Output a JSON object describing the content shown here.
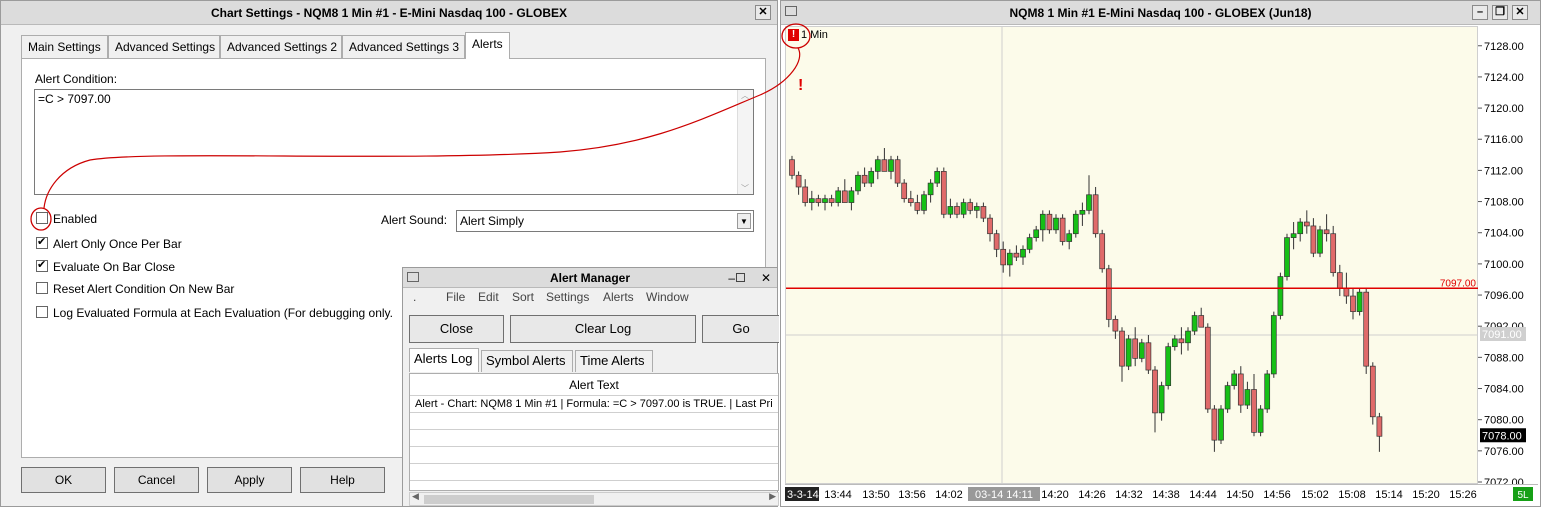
{
  "settings_window": {
    "title": "Chart Settings - NQM8  1 Min   #1 - E-Mini Nasdaq 100 - GLOBEX",
    "tabs": [
      "Main Settings",
      "Advanced Settings",
      "Advanced Settings 2",
      "Advanced Settings 3",
      "Alerts"
    ],
    "active_tab": "Alerts",
    "alert_condition_label": "Alert Condition:",
    "alert_condition_value": "=C > 7097.00",
    "enabled_label": "Enabled",
    "enabled_checked": false,
    "alert_sound_label": "Alert Sound:",
    "alert_sound_value": "Alert Simply",
    "options": [
      {
        "label": "Alert Only Once Per Bar",
        "checked": true
      },
      {
        "label": "Evaluate On Bar Close",
        "checked": true
      },
      {
        "label": "Reset Alert Condition On New Bar",
        "checked": false
      },
      {
        "label": "Log Evaluated Formula at Each Evaluation (For debugging only.",
        "checked": false
      }
    ],
    "buttons": {
      "ok": "OK",
      "cancel": "Cancel",
      "apply": "Apply",
      "help": "Help"
    },
    "close_glyph": "✕"
  },
  "alert_manager": {
    "title": "Alert Manager",
    "menu": [
      ".",
      "File",
      "Edit",
      "Sort",
      "Settings",
      "Alerts",
      "Window"
    ],
    "buttons": {
      "close": "Close",
      "clear_log": "Clear Log",
      "go": "Go"
    },
    "tabs": [
      "Alerts Log",
      "Symbol Alerts",
      "Time Alerts"
    ],
    "active_tab": "Alerts Log",
    "column_header": "Alert Text",
    "rows": [
      "Alert - Chart: NQM8  1 Min   #1 | Formula: =C > 7097.00 is TRUE.  | Last Pri"
    ]
  },
  "chart_window": {
    "title": "NQM8  1 Min   #1  E-Mini Nasdaq 100 - GLOBEX (Jun18)",
    "interval_label": "1 Min",
    "alert_marker": "!",
    "price_line_label": "7097.00",
    "last_price_label": "7078.00",
    "crosshair_price_label": "7091.00",
    "crosshair_time_label": "03-14  14:11",
    "date_label": "3-3-14",
    "corner_label": "5L",
    "colors": {
      "background": "#fcfbea",
      "up": "#16c016",
      "down": "#e06a6a",
      "alert_line": "#e00000"
    }
  },
  "chart_data": {
    "type": "candlestick",
    "title": "NQM8  1 Min   #1  E-Mini Nasdaq 100 - GLOBEX (Jun18)",
    "xlabel": "",
    "ylabel": "",
    "ylim": [
      7072.0,
      7130.0
    ],
    "y_ticks": [
      7128.0,
      7124.0,
      7120.0,
      7116.0,
      7112.0,
      7108.0,
      7104.0,
      7100.0,
      7096.0,
      7092.0,
      7088.0,
      7084.0,
      7080.0,
      7076.0,
      7072.0
    ],
    "x_ticks": [
      "13:44",
      "13:50",
      "13:56",
      "14:02",
      "14:20",
      "14:26",
      "14:32",
      "14:38",
      "14:44",
      "14:50",
      "14:56",
      "15:02",
      "15:08",
      "15:14",
      "15:20",
      "15:26"
    ],
    "horizontal_line": 7097.0,
    "last_price": 7078.0,
    "series": [
      {
        "values": [
          [
            7113.5,
            7114,
            7111,
            7111.5
          ],
          [
            7111.5,
            7112,
            7109,
            7110
          ],
          [
            7110,
            7111,
            7107.5,
            7108
          ],
          [
            7108,
            7109.5,
            7107,
            7108.5
          ],
          [
            7108.5,
            7109,
            7107.5,
            7108
          ],
          [
            7108,
            7109,
            7107,
            7108.5
          ],
          [
            7108.5,
            7109,
            7107.5,
            7108
          ],
          [
            7108,
            7110,
            7107.5,
            7109.5
          ],
          [
            7109.5,
            7111,
            7108,
            7108
          ],
          [
            7108,
            7110,
            7107,
            7109.5
          ],
          [
            7109.5,
            7112,
            7109,
            7111.5
          ],
          [
            7111.5,
            7112.5,
            7110,
            7110.5
          ],
          [
            7110.5,
            7112.5,
            7110,
            7112
          ],
          [
            7112,
            7114,
            7111,
            7113.5
          ],
          [
            7113.5,
            7115,
            7112,
            7112
          ],
          [
            7112,
            7114,
            7111,
            7113.5
          ],
          [
            7113.5,
            7114,
            7110,
            7110.5
          ],
          [
            7110.5,
            7111,
            7108,
            7108.5
          ],
          [
            7108.5,
            7109.5,
            7107.5,
            7108
          ],
          [
            7108,
            7109,
            7106.5,
            7107
          ],
          [
            7107,
            7109.5,
            7106.5,
            7109
          ],
          [
            7109,
            7111,
            7108,
            7110.5
          ],
          [
            7110.5,
            7112.5,
            7110,
            7112
          ],
          [
            7112,
            7112.5,
            7106,
            7106.5
          ],
          [
            7106.5,
            7108.5,
            7106,
            7107.5
          ],
          [
            7107.5,
            7108,
            7106,
            7106.5
          ],
          [
            7106.5,
            7108.5,
            7106,
            7108
          ],
          [
            7108,
            7108.5,
            7106.5,
            7107
          ],
          [
            7107,
            7108,
            7106,
            7107.5
          ],
          [
            7107.5,
            7108,
            7105.5,
            7106
          ],
          [
            7106,
            7106.5,
            7103,
            7104
          ],
          [
            7104,
            7104.5,
            7101,
            7102
          ],
          [
            7102,
            7103,
            7099,
            7100
          ],
          [
            7100,
            7102,
            7098.5,
            7101.5
          ],
          [
            7101.5,
            7102.5,
            7100.5,
            7101
          ],
          [
            7101,
            7102.5,
            7100,
            7102
          ],
          [
            7102,
            7104,
            7101.5,
            7103.5
          ],
          [
            7103.5,
            7105,
            7103,
            7104.5
          ],
          [
            7104.5,
            7107,
            7103,
            7106.5
          ],
          [
            7106.5,
            7107,
            7104,
            7104.5
          ],
          [
            7104.5,
            7106.5,
            7104,
            7106
          ],
          [
            7106,
            7106.5,
            7102.5,
            7103
          ],
          [
            7103,
            7104.5,
            7102,
            7104
          ],
          [
            7104,
            7107,
            7103.5,
            7106.5
          ],
          [
            7106.5,
            7108,
            7105,
            7107
          ],
          [
            7107,
            7111.5,
            7106.5,
            7109
          ],
          [
            7109,
            7110,
            7103.5,
            7104
          ],
          [
            7104,
            7104.5,
            7099,
            7099.5
          ],
          [
            7099.5,
            7100,
            7092,
            7093
          ],
          [
            7093,
            7093.5,
            7090.5,
            7091.5
          ],
          [
            7091.5,
            7092,
            7085,
            7087
          ],
          [
            7087,
            7091,
            7086.5,
            7090.5
          ],
          [
            7090.5,
            7092,
            7087,
            7088
          ],
          [
            7088,
            7090.5,
            7087.5,
            7090
          ],
          [
            7090,
            7091,
            7086,
            7086.5
          ],
          [
            7086.5,
            7087,
            7078.5,
            7081
          ],
          [
            7081,
            7085,
            7080,
            7084.5
          ],
          [
            7084.5,
            7090,
            7084,
            7089.5
          ],
          [
            7089.5,
            7091,
            7089,
            7090.5
          ],
          [
            7090.5,
            7092,
            7088.5,
            7090
          ],
          [
            7090,
            7092,
            7089,
            7091.5
          ],
          [
            7091.5,
            7094,
            7091,
            7093.5
          ],
          [
            7093.5,
            7094.5,
            7092,
            7092
          ],
          [
            7092,
            7092.5,
            7081,
            7081.5
          ],
          [
            7081.5,
            7082,
            7076,
            7077.5
          ],
          [
            7077.5,
            7082,
            7077,
            7081.5
          ],
          [
            7081.5,
            7085,
            7081,
            7084.5
          ],
          [
            7084.5,
            7086.5,
            7084,
            7086
          ],
          [
            7086,
            7087,
            7081,
            7082
          ],
          [
            7082,
            7085,
            7081.5,
            7084
          ],
          [
            7084,
            7086,
            7078,
            7078.5
          ],
          [
            7078.5,
            7082,
            7078,
            7081.5
          ],
          [
            7081.5,
            7086.5,
            7081,
            7086
          ],
          [
            7086,
            7094,
            7085.5,
            7093.5
          ],
          [
            7093.5,
            7099,
            7093,
            7098.5
          ],
          [
            7098.5,
            7104,
            7098,
            7103.5
          ],
          [
            7103.5,
            7105.5,
            7102,
            7104
          ],
          [
            7104,
            7106,
            7103,
            7105.5
          ],
          [
            7105.5,
            7107,
            7104,
            7105
          ],
          [
            7105,
            7106,
            7101,
            7101.5
          ],
          [
            7101.5,
            7105,
            7101,
            7104.5
          ],
          [
            7104.5,
            7106.5,
            7103,
            7104
          ],
          [
            7104,
            7105,
            7098.5,
            7099
          ],
          [
            7099,
            7100,
            7096,
            7097
          ],
          [
            7097,
            7099,
            7095,
            7096
          ],
          [
            7096,
            7097,
            7093,
            7094
          ],
          [
            7094,
            7097,
            7093.5,
            7096.5
          ],
          [
            7096.5,
            7097,
            7086,
            7087
          ],
          [
            7087,
            7087.5,
            7079.5,
            7080.5
          ],
          [
            7080.5,
            7081,
            7076,
            7078
          ]
        ]
      }
    ]
  }
}
